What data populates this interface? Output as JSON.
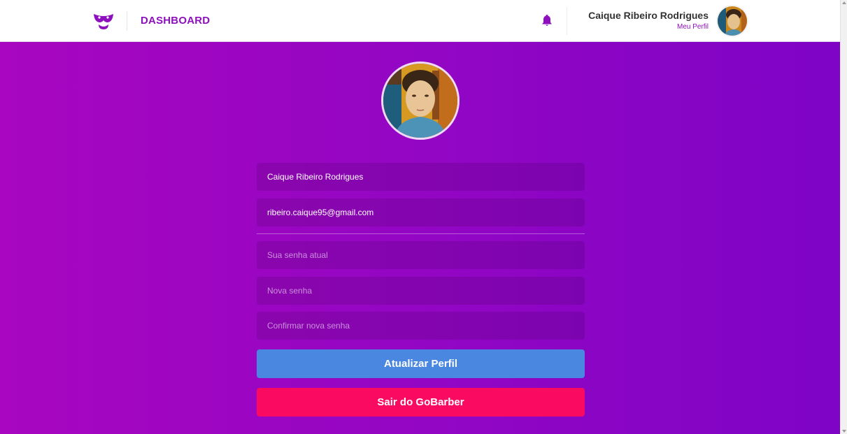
{
  "header": {
    "logo_icon": "mustache-icon",
    "dashboard_label": "DASHBOARD",
    "notification_icon": "bell-icon",
    "user_name": "Caique Ribeiro Rodrigues",
    "profile_link": "Meu Perfil"
  },
  "profile_form": {
    "avatar_icon": "user-photo",
    "name_value": "Caique Ribeiro Rodrigues",
    "email_value": "ribeiro.caique95@gmail.com",
    "old_password_placeholder": "Sua senha atual",
    "new_password_placeholder": "Nova senha",
    "confirm_password_placeholder": "Confirmar nova senha",
    "update_button": "Atualizar Perfil",
    "logout_button": "Sair do GoBarber"
  },
  "colors": {
    "brand_purple": "#8d0fbd",
    "update_button": "#4a87e0",
    "logout_button": "#fb0a62",
    "gradient_left": "#a806c0",
    "gradient_right": "#7f04c6"
  }
}
